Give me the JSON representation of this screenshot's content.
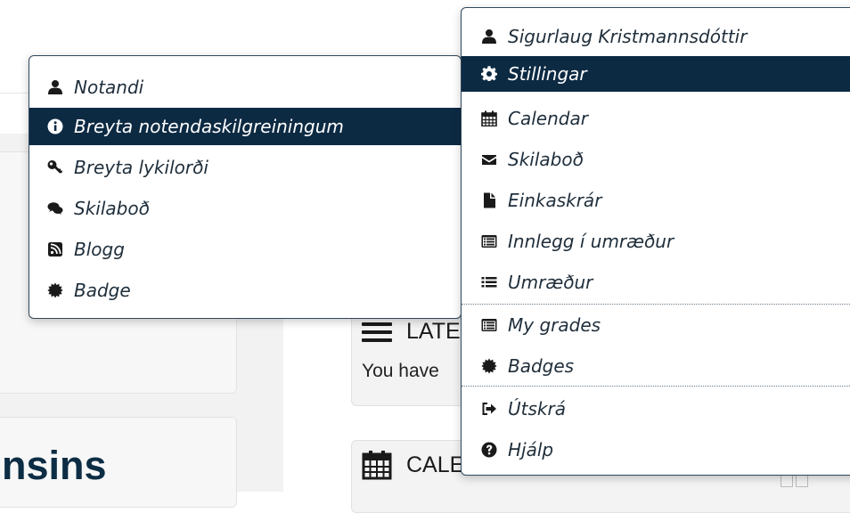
{
  "background": {
    "heading_fragment": "nsins",
    "latest_block_title": "LATE",
    "latest_block_text": "You have",
    "calendar_block_title": "CALENDAR"
  },
  "user_menu": {
    "items": [
      {
        "label": "Notandi",
        "icon": "user-icon"
      },
      {
        "label": "Breyta notendaskilgreiningum",
        "icon": "info-circle-icon",
        "active": true
      },
      {
        "label": "Breyta lykilorði",
        "icon": "key-icon"
      },
      {
        "label": "Skilaboð",
        "icon": "comments-icon"
      },
      {
        "label": "Blogg",
        "icon": "rss-square-icon"
      },
      {
        "label": "Badge",
        "icon": "certificate-icon"
      }
    ]
  },
  "main_menu": {
    "items": [
      {
        "label": "Sigurlaug Kristmannsdóttir",
        "icon": "user-icon"
      },
      {
        "label": "Stillingar",
        "icon": "cog-icon",
        "active": true
      },
      {
        "label": "Calendar",
        "icon": "calendar-icon"
      },
      {
        "label": "Skilaboð",
        "icon": "envelope-icon"
      },
      {
        "label": "Einkaskrár",
        "icon": "file-icon"
      },
      {
        "label": "Innlegg í umræður",
        "icon": "list-alt-icon"
      },
      {
        "label": "Umræður",
        "icon": "list-icon"
      },
      {
        "label": "My grades",
        "icon": "list-alt-icon"
      },
      {
        "label": "Badges",
        "icon": "certificate-icon"
      },
      {
        "label": "Útskrá",
        "icon": "sign-out-icon"
      },
      {
        "label": "Hjálp",
        "icon": "question-circle-icon"
      }
    ]
  },
  "colors": {
    "active_background": "#0d2a43",
    "menu_border": "#30475a",
    "item_text": "#1f2e3b"
  }
}
